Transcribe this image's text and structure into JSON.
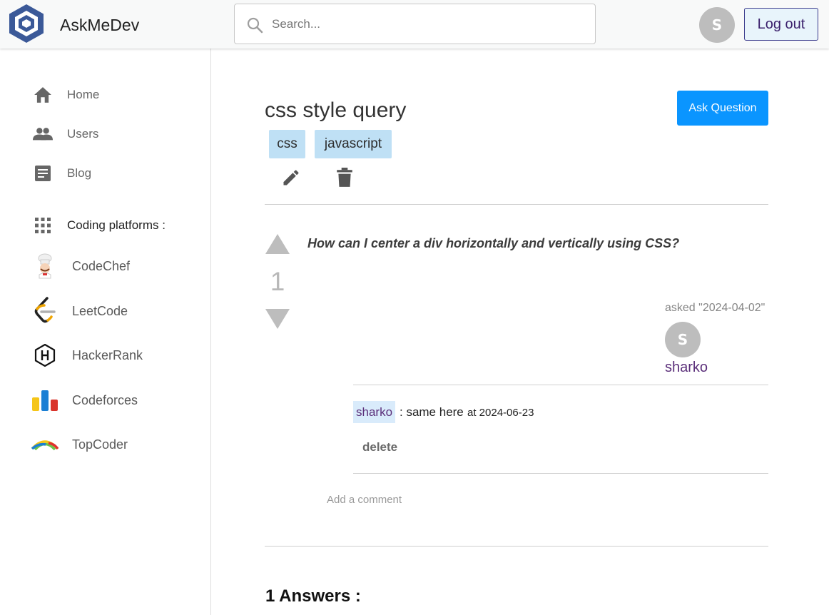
{
  "header": {
    "brand": "AskMeDev",
    "search_placeholder": "Search...",
    "avatar_initial": "S",
    "logout_label": "Log out"
  },
  "sidebar": {
    "items": [
      {
        "label": "Home",
        "icon": "home-icon"
      },
      {
        "label": "Users",
        "icon": "users-icon"
      },
      {
        "label": "Blog",
        "icon": "article-icon"
      }
    ],
    "platforms_heading": "Coding platforms :",
    "platforms": [
      {
        "label": "CodeChef",
        "icon": "codechef-logo"
      },
      {
        "label": "LeetCode",
        "icon": "leetcode-logo"
      },
      {
        "label": "HackerRank",
        "icon": "hackerrank-logo"
      },
      {
        "label": "Codeforces",
        "icon": "codeforces-logo"
      },
      {
        "label": "TopCoder",
        "icon": "topcoder-logo"
      }
    ]
  },
  "question": {
    "title": "css style query",
    "ask_button": "Ask Question",
    "tags": [
      "css",
      "javascript"
    ],
    "votes": "1",
    "body": "How can I center a div horizontally and vertically using CSS?",
    "asked": "asked \"2024-04-02\"",
    "author_initial": "S",
    "author": "sharko"
  },
  "comment": {
    "user": "sharko",
    "text": ": same here",
    "at": "at 2024-06-23",
    "delete_label": "delete"
  },
  "add_comment": "Add a comment",
  "answers_heading": "1 Answers :",
  "colors": {
    "accent": "#0a95ff",
    "tag_bg": "#bfe0f5",
    "user_link": "#5b2f7a"
  }
}
